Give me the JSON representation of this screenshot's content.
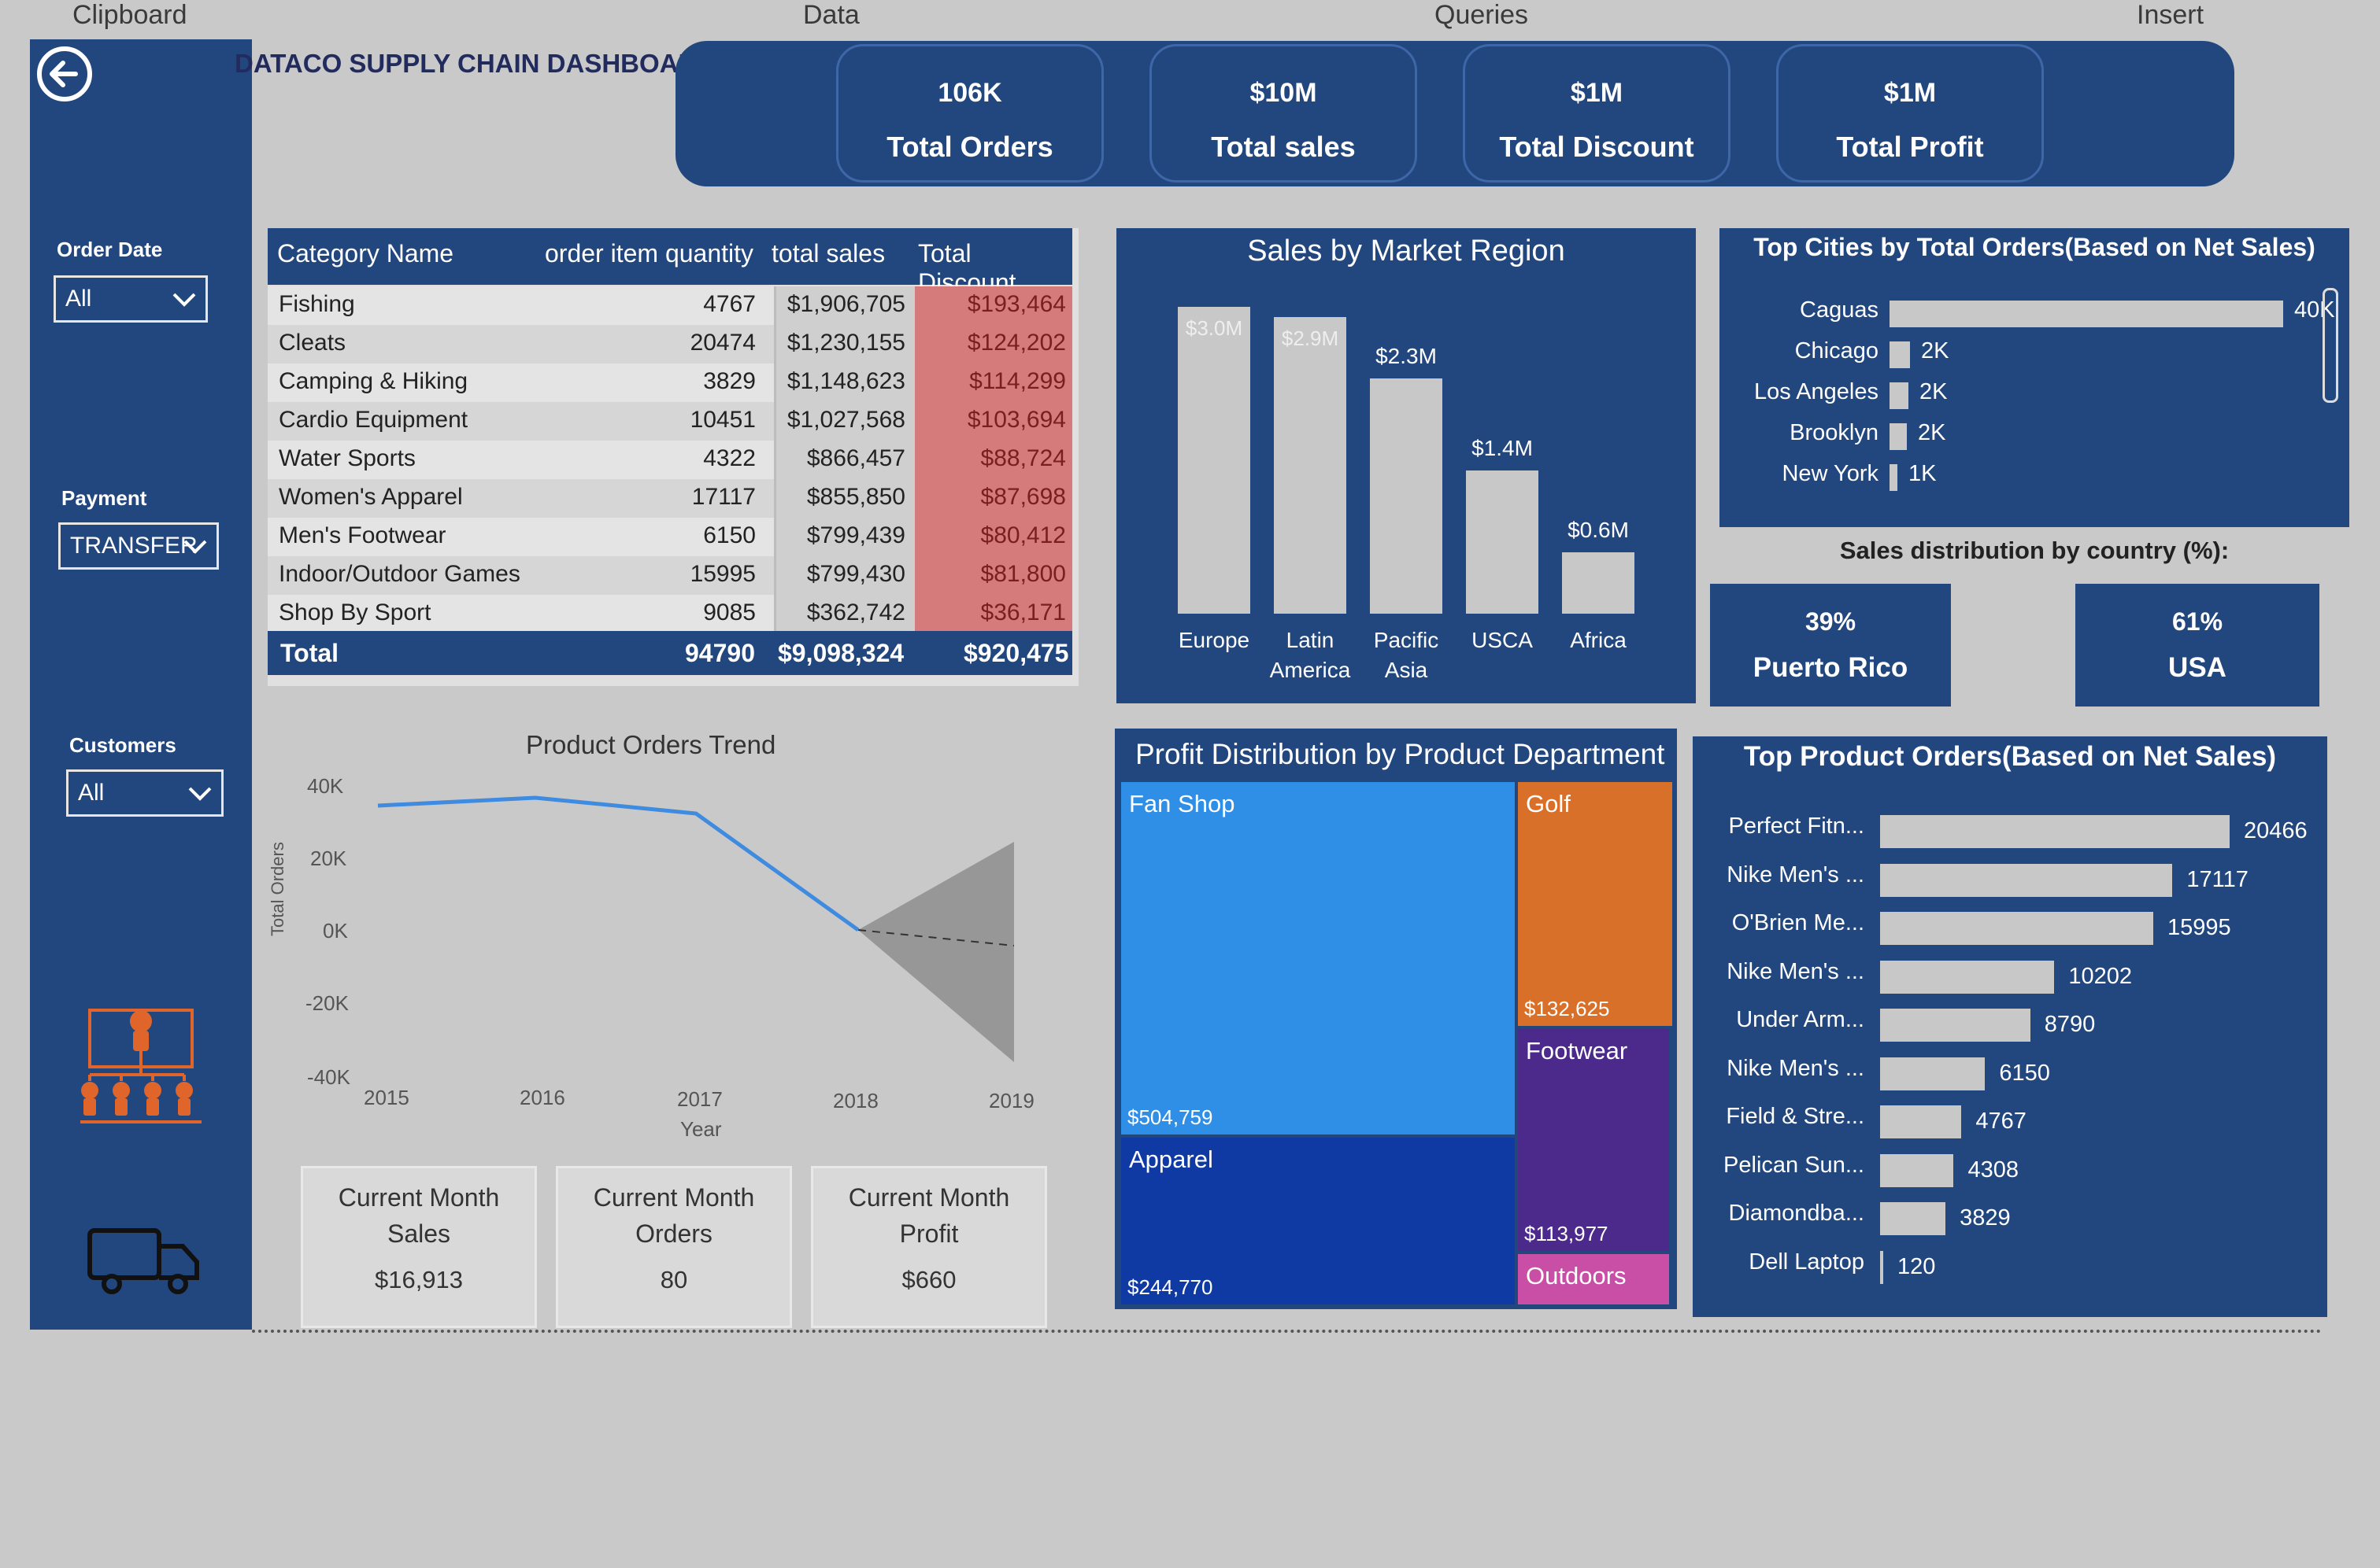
{
  "ribbon": {
    "clipboard": "Clipboard",
    "data": "Data",
    "queries": "Queries",
    "insert": "Insert"
  },
  "dashboard_title": "DATACO SUPPLY CHAIN DASHBOARD",
  "filters": {
    "order_date": {
      "label": "Order Date",
      "value": "All"
    },
    "payment": {
      "label": "Payment",
      "value": "TRANSFER"
    },
    "customers": {
      "label": "Customers",
      "value": "All"
    }
  },
  "kpis": [
    {
      "value": "106K",
      "label": "Total Orders"
    },
    {
      "value": "$10M",
      "label": "Total sales"
    },
    {
      "value": "$1M",
      "label": "Total Discount"
    },
    {
      "value": "$1M",
      "label": "Total Profit"
    }
  ],
  "category_table": {
    "headers": [
      "Category Name",
      "order item quantity",
      "total sales",
      "Total Discount"
    ],
    "rows": [
      {
        "name": "Fishing",
        "qty": "4767",
        "sales": "$1,906,705",
        "discount": "$193,464"
      },
      {
        "name": "Cleats",
        "qty": "20474",
        "sales": "$1,230,155",
        "discount": "$124,202"
      },
      {
        "name": "Camping & Hiking",
        "qty": "3829",
        "sales": "$1,148,623",
        "discount": "$114,299"
      },
      {
        "name": "Cardio Equipment",
        "qty": "10451",
        "sales": "$1,027,568",
        "discount": "$103,694"
      },
      {
        "name": "Water Sports",
        "qty": "4322",
        "sales": "$866,457",
        "discount": "$88,724"
      },
      {
        "name": "Women's Apparel",
        "qty": "17117",
        "sales": "$855,850",
        "discount": "$87,698"
      },
      {
        "name": "Men's Footwear",
        "qty": "6150",
        "sales": "$799,439",
        "discount": "$80,412"
      },
      {
        "name": "Indoor/Outdoor Games",
        "qty": "15995",
        "sales": "$799,430",
        "discount": "$81,800"
      },
      {
        "name": "Shop By Sport",
        "qty": "9085",
        "sales": "$362,742",
        "discount": "$36,171"
      }
    ],
    "total": {
      "label": "Total",
      "qty": "94790",
      "sales": "$9,098,324",
      "discount": "$920,475"
    }
  },
  "trend": {
    "title": "Product Orders Trend",
    "ylabel": "Total Orders",
    "xlabel": "Year",
    "yticks": [
      "40K",
      "20K",
      "0K",
      "-20K",
      "-40K"
    ],
    "xticks": [
      "2015",
      "2016",
      "2017",
      "2018",
      "2019"
    ]
  },
  "mini_cards": [
    {
      "title_1": "Current Month",
      "title_2": "Sales",
      "value": "$16,913"
    },
    {
      "title_1": "Current Month",
      "title_2": "Orders",
      "value": "80"
    },
    {
      "title_1": "Current Month",
      "title_2": "Profit",
      "value": "$660"
    }
  ],
  "market_region": {
    "title": "Sales by Market Region",
    "bars": [
      {
        "label": "Europe",
        "label2": "",
        "value": "$3.0M"
      },
      {
        "label": "Latin",
        "label2": "America",
        "value": "$2.9M"
      },
      {
        "label": "Pacific",
        "label2": "Asia",
        "value": "$2.3M"
      },
      {
        "label": "USCA",
        "label2": "",
        "value": "$1.4M"
      },
      {
        "label": "Africa",
        "label2": "",
        "value": "$0.6M"
      }
    ]
  },
  "top_cities": {
    "title": "Top Cities by Total Orders(Based on Net Sales)",
    "rows": [
      {
        "city": "Caguas",
        "value": "40K"
      },
      {
        "city": "Chicago",
        "value": "2K"
      },
      {
        "city": "Los Angeles",
        "value": "2K"
      },
      {
        "city": "Brooklyn",
        "value": "2K"
      },
      {
        "city": "New York",
        "value": "1K"
      }
    ]
  },
  "country_dist": {
    "title": "Sales distribution by country (%):",
    "cards": [
      {
        "pct": "39%",
        "country": "Puerto Rico"
      },
      {
        "pct": "61%",
        "country": "USA"
      }
    ]
  },
  "profit_dept": {
    "title": "Profit Distribution by Product Department",
    "cells": [
      {
        "name": "Fan Shop",
        "value": "$504,759",
        "color": "#2f8ee6"
      },
      {
        "name": "Apparel",
        "value": "$244,770",
        "color": "#0f39a3"
      },
      {
        "name": "Golf",
        "value": "$132,625",
        "color": "#d9702a"
      },
      {
        "name": "Footwear",
        "value": "$113,977",
        "color": "#4b2a8c"
      },
      {
        "name": "Outdoors",
        "value": "",
        "color": "#c84ea6"
      }
    ]
  },
  "top_products": {
    "title": "Top Product Orders(Based on Net Sales)",
    "rows": [
      {
        "name": "Perfect Fitn...",
        "value": "20466"
      },
      {
        "name": "Nike Men's ...",
        "value": "17117"
      },
      {
        "name": "O'Brien Me...",
        "value": "15995"
      },
      {
        "name": "Nike Men's ...",
        "value": "10202"
      },
      {
        "name": "Under Arm...",
        "value": "8790"
      },
      {
        "name": "Nike Men's ...",
        "value": "6150"
      },
      {
        "name": "Field & Stre...",
        "value": "4767"
      },
      {
        "name": "Pelican Sun...",
        "value": "4308"
      },
      {
        "name": "Diamondba...",
        "value": "3829"
      },
      {
        "name": "Dell Laptop",
        "value": "120"
      }
    ]
  },
  "colors": {
    "panel": "#22477e",
    "background": "#c9c9c9",
    "bar": "#c8c8c8",
    "discount": "#d57b7b",
    "trend_line": "#3f8be0"
  }
}
